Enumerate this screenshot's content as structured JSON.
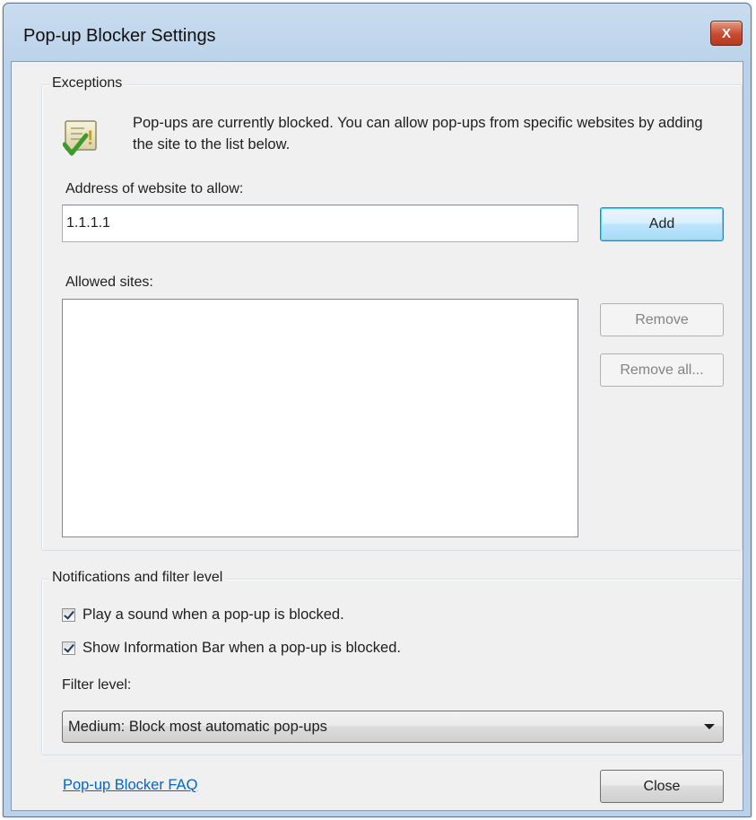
{
  "window": {
    "title": "Pop-up Blocker Settings",
    "close_glyph": "X"
  },
  "exceptions": {
    "group_label": "Exceptions",
    "info_icon": "shield-check-warning-icon",
    "info_text": "Pop-ups are currently blocked.  You can allow pop-ups from specific websites by adding the site to the list below.",
    "address_label": "Address of website to allow:",
    "address_value": "1.1.1.1",
    "add_label": "Add",
    "allowed_label": "Allowed sites:",
    "allowed_sites": [],
    "remove_label": "Remove",
    "remove_all_label": "Remove all..."
  },
  "notifications": {
    "group_label": "Notifications and filter level",
    "play_sound_label": "Play a sound when a pop-up is blocked.",
    "play_sound_checked": true,
    "show_infobar_label": "Show Information Bar when a pop-up is blocked.",
    "show_infobar_checked": true,
    "filter_label": "Filter level:",
    "filter_value": "Medium: Block most automatic pop-ups"
  },
  "footer": {
    "faq_link": "Pop-up Blocker FAQ",
    "close_label": "Close"
  },
  "colors": {
    "link": "#0066cc",
    "frame": "#b9d1ea",
    "client_bg": "#f0f0f0",
    "close_button": "#c84a30"
  }
}
